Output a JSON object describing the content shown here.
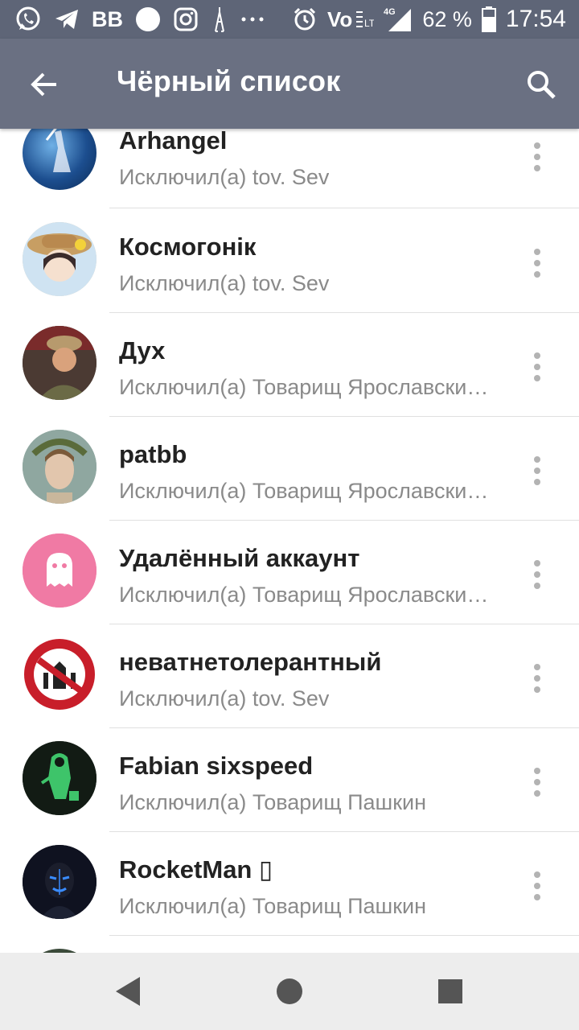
{
  "status_bar": {
    "vk_label": "BB",
    "battery_percent": "62 %",
    "network": "4G",
    "time": "17:54"
  },
  "app_bar": {
    "title": "Чёрный список"
  },
  "list": [
    {
      "name": "Arhangel",
      "sub": "Исключил(а) tov. Sev",
      "avatar_color": "#1a3f7a"
    },
    {
      "name": "Космогонік",
      "sub": "Исключил(а) tov. Sev",
      "avatar_color": "#c9b08a"
    },
    {
      "name": "Дух",
      "sub": "Исключил(а) Товарищ Ярославски…",
      "avatar_color": "#6b4a3a"
    },
    {
      "name": "patbb",
      "sub": "Исключил(а) Товарищ Ярославски…",
      "avatar_color": "#8aa39b"
    },
    {
      "name": "Удалённый аккаунт",
      "sub": "Исключил(а) Товарищ Ярославски…",
      "avatar_color": "#f07aa4"
    },
    {
      "name": "неватнетолерантный",
      "sub": "Исключил(а) tov. Sev",
      "avatar_color": "#c81e2a"
    },
    {
      "name": "Fabian sixspeed",
      "sub": "Исключил(а) Товарищ Пашкин",
      "avatar_color": "#1c3a24"
    },
    {
      "name": "RocketMan ▯",
      "sub": "Исключил(а) Товарищ Пашкин",
      "avatar_color": "#151826"
    }
  ],
  "colors": {
    "status_bar": "#5e6577",
    "app_bar": "#6a7082",
    "name_text": "#222222",
    "sub_text": "#8a8a8a"
  }
}
